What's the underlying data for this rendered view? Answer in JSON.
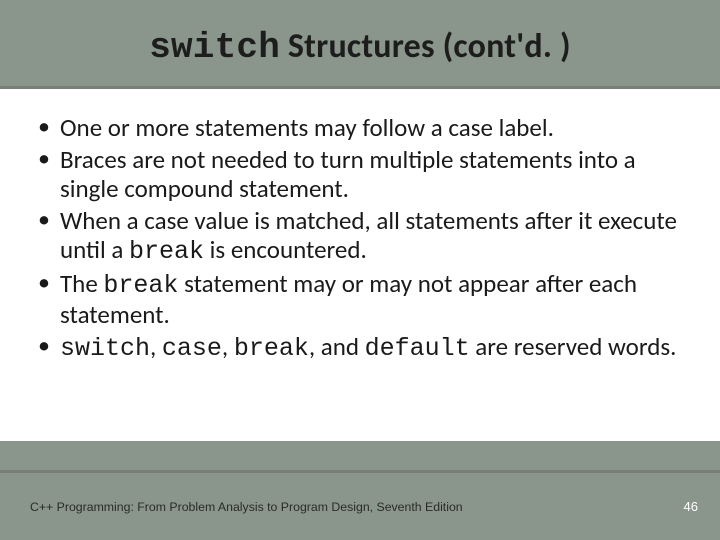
{
  "title": {
    "code": "switch",
    "rest": " Structures (cont'd. )"
  },
  "bullets": [
    {
      "pre": "One or more statements may follow a case label."
    },
    {
      "pre": "Braces are not needed to turn multiple statements into a single compound statement."
    },
    {
      "pre": "When a case value is matched, all statements after it execute until a ",
      "code1": "break",
      "mid1": " is encountered."
    },
    {
      "pre": "The ",
      "code1": "break",
      "mid1": " statement may or may not appear after each statement."
    },
    {
      "code1": "switch",
      "mid1": ", ",
      "code2": "case",
      "mid2": ", ",
      "code3": "break",
      "mid3": ", and ",
      "code4": "default",
      "mid4": " are reserved words."
    }
  ],
  "footer": {
    "text": "C++ Programming: From Problem Analysis to Program Design, Seventh Edition",
    "page": "46"
  }
}
